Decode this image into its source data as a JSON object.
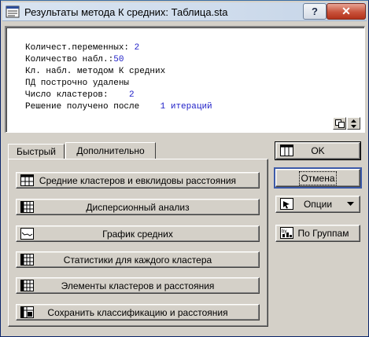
{
  "window": {
    "title": "Результаты метода К средних: Таблица.sta",
    "help_label": "?",
    "close_label": "✕"
  },
  "output": {
    "lines": [
      {
        "label": "Количест.переменных: ",
        "value": "2"
      },
      {
        "label": "Количество набл.:",
        "value": "50"
      },
      {
        "label": "Кл. набл. методом К средних",
        "value": ""
      },
      {
        "label": "ПД построчно удалены",
        "value": ""
      },
      {
        "label": "Число кластеров:    ",
        "value": "2"
      },
      {
        "label": "Решение получено после    ",
        "value": "1 итераций"
      }
    ],
    "copy_icon": "copy-icon",
    "expand_icon": "expand-icon"
  },
  "tabs": [
    {
      "label": "Быстрый",
      "active": false
    },
    {
      "label": "Дополнительно",
      "active": true
    }
  ],
  "actions": [
    {
      "label": "Средние кластеров и евклидовы расстояния",
      "icon": "table-icon"
    },
    {
      "label": "Дисперсионный анализ",
      "icon": "spreadsheet-icon"
    },
    {
      "label": "График средних",
      "icon": "line-chart-icon"
    },
    {
      "label": "Статистики для каждого кластера",
      "icon": "spreadsheet-icon"
    },
    {
      "label": "Элементы кластеров и расстояния",
      "icon": "spreadsheet-icon"
    },
    {
      "label": "Сохранить классификацию и расстояния",
      "icon": "save-data-icon"
    }
  ],
  "side": {
    "ok_label": "OK",
    "cancel_label": "Отмена",
    "options_label": "Опции",
    "by_group_label": "По Группам"
  }
}
